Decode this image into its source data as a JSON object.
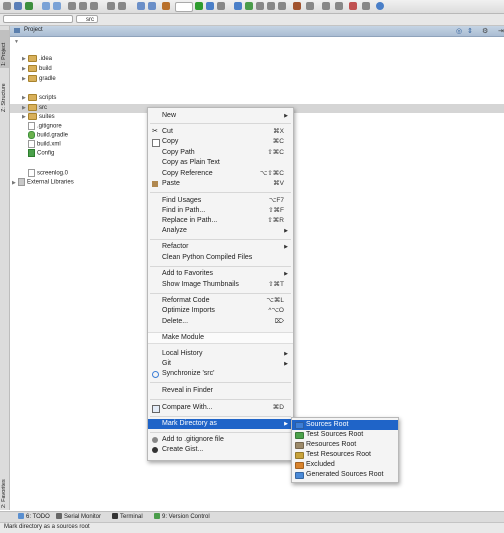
{
  "navbar": {
    "crumb1": "",
    "crumb2": "src"
  },
  "side_tabs": {
    "project": "1: Project",
    "structure": "Z: Structure",
    "favorites": "2: Favorites"
  },
  "project_panel": {
    "title": "Project"
  },
  "tree": [
    {
      "label": ".idea",
      "kind": "folder"
    },
    {
      "label": "build",
      "kind": "folder"
    },
    {
      "label": "gradle",
      "kind": "folder"
    },
    {
      "label": "scripts",
      "kind": "folder"
    },
    {
      "label": "src",
      "kind": "folder"
    },
    {
      "label": "suites",
      "kind": "folder"
    },
    {
      "label": ".gitignore",
      "kind": "file"
    },
    {
      "label": "build.gradle",
      "kind": "gradle"
    },
    {
      "label": "build.xml",
      "kind": "file"
    },
    {
      "label": "Config",
      "kind": "config"
    },
    {
      "label": "screenlog.0",
      "kind": "file"
    },
    {
      "label": "External Libraries",
      "kind": "lib"
    }
  ],
  "menu": {
    "new": "New",
    "cut": "Cut",
    "cut_sc": "⌘X",
    "copy": "Copy",
    "copy_sc": "⌘C",
    "copy_path": "Copy Path",
    "copy_path_sc": "⇧⌘C",
    "copy_plain": "Copy as Plain Text",
    "copy_ref": "Copy Reference",
    "copy_ref_sc": "⌥⇧⌘C",
    "paste": "Paste",
    "paste_sc": "⌘V",
    "find_usages": "Find Usages",
    "find_usages_sc": "⌥F7",
    "find_in_path": "Find in Path...",
    "find_in_path_sc": "⇧⌘F",
    "replace_in_path": "Replace in Path...",
    "replace_in_path_sc": "⇧⌘R",
    "analyze": "Analyze",
    "refactor": "Refactor",
    "clean_python": "Clean Python Compiled Files",
    "add_favorites": "Add to Favorites",
    "show_thumbs": "Show Image Thumbnails",
    "show_thumbs_sc": "⇧⌘T",
    "reformat": "Reformat Code",
    "reformat_sc": "⌥⌘L",
    "optimize": "Optimize Imports",
    "optimize_sc": "^⌥O",
    "delete": "Delete...",
    "delete_sc": "⌦",
    "make_module": "Make Module",
    "local_history": "Local History",
    "git": "Git",
    "synchronize": "Synchronize 'src'",
    "reveal": "Reveal in Finder",
    "compare": "Compare With...",
    "compare_sc": "⌘D",
    "mark_dir": "Mark Directory as",
    "add_gitignore": "Add to .gitignore file",
    "create_gist": "Create Gist..."
  },
  "submenu": [
    {
      "label": "Sources Root",
      "color": "#3d7ed6"
    },
    {
      "label": "Test Sources Root",
      "color": "#4ba24b"
    },
    {
      "label": "Resources Root",
      "color": "#9c8a6a"
    },
    {
      "label": "Test Resources Root",
      "color": "#c8a23a"
    },
    {
      "label": "Excluded",
      "color": "#d9822b"
    },
    {
      "label": "Generated Sources Root",
      "color": "#4a8ad8"
    }
  ],
  "bottom_tools": {
    "todo": "6: TODO",
    "serial": "Serial Monitor",
    "terminal": "Terminal",
    "vcs": "9: Version Control"
  },
  "status": {
    "text": "Mark directory as a sources root"
  }
}
